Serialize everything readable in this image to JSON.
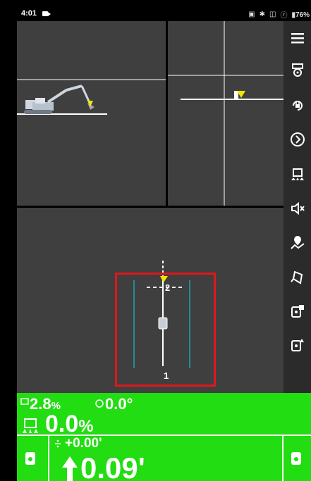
{
  "status_bar": {
    "time": "4:01",
    "battery": "76%",
    "icons": [
      "cast-icon",
      "bluetooth-icon",
      "vibrate-icon",
      "signal-icon",
      "battery-icon"
    ]
  },
  "sidebar": {
    "items": [
      {
        "name": "menu-icon"
      },
      {
        "name": "machine-settings-icon"
      },
      {
        "name": "lock-rotate-icon"
      },
      {
        "name": "next-icon"
      },
      {
        "name": "machine-grade-icon"
      },
      {
        "name": "mute-icon"
      },
      {
        "name": "map-location-icon"
      },
      {
        "name": "bucket-icon"
      },
      {
        "name": "total-station-settings-icon"
      },
      {
        "name": "total-station-up-icon"
      }
    ]
  },
  "plan_view": {
    "line_label_top": "2",
    "line_label_bottom": "1"
  },
  "readouts": {
    "slope_value": "2.8",
    "slope_unit": "%",
    "rotation_value": "0.0°",
    "cross_slope_value": "0.0",
    "cross_slope_unit": "%",
    "elevation_offset": "+0.00'",
    "cut_fill_value": "0.09'"
  },
  "colors": {
    "status_green": "#22dd11",
    "highlight_red": "#e0171b",
    "guide_line": "#1aa7b0",
    "target_yellow": "#f2e600"
  }
}
